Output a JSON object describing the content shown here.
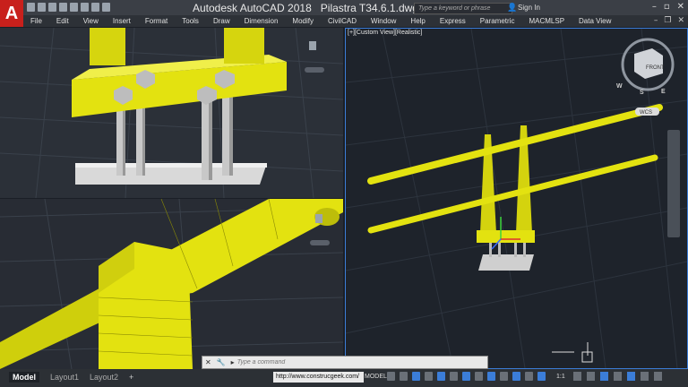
{
  "title": {
    "app": "Autodesk AutoCAD 2018",
    "file": "Pilastra T34.6.1.dwg"
  },
  "logo": "A",
  "search": {
    "placeholder": "Type a keyword or phrase"
  },
  "signin": "Sign In",
  "menu": [
    "File",
    "Edit",
    "View",
    "Insert",
    "Format",
    "Tools",
    "Draw",
    "Dimension",
    "Modify",
    "CivilCAD",
    "Window",
    "Help",
    "Express",
    "Parametric",
    "MACMLSP",
    "Data View"
  ],
  "viewports": {
    "right_label": "[+][Custom View][Realistic]"
  },
  "viewcube": {
    "face": "FRONT",
    "compass": {
      "w": "W",
      "s": "S",
      "e": "E"
    },
    "ucs": "WCS"
  },
  "command": {
    "placeholder": "Type a command"
  },
  "layout_tabs": {
    "model": "Model",
    "layout1": "Layout1",
    "layout2": "Layout2",
    "add": "+"
  },
  "status": {
    "url": "http://www.construcgeek.com/",
    "model": "MODEL",
    "scale": "1:1"
  },
  "colors": {
    "yellow": "#e3e210",
    "bg": "#1e232b",
    "accent": "#3b7dd8"
  }
}
